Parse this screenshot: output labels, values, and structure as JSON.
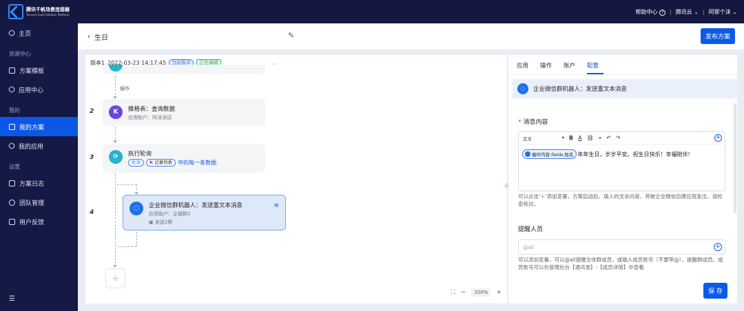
{
  "topbar": {
    "logo_title": "腾讯千帆场景连接器",
    "logo_subtitle": "Tencent SaaS Solution Platform",
    "help": "帮助中心",
    "cloud": "腾讯云",
    "user": "阿那个沫"
  },
  "sidebar": {
    "home": "主页",
    "group_resources": "资源中心",
    "templates": "方案模板",
    "app_center": "应用中心",
    "group_mine": "我的",
    "my_solutions": "我的方案",
    "my_apps": "我的应用",
    "group_settings": "设置",
    "logs": "方案日志",
    "team": "团队管理",
    "feedback": "用户反馈"
  },
  "header": {
    "back_title": "生日",
    "publish": "发布方案"
  },
  "canvas": {
    "version_label": "版本1",
    "version_time": "2022-03-23 14:17:45",
    "badge_current": "当前版本",
    "badge_editing": "正在编辑",
    "op_label": "操作",
    "steps": [
      {
        "num": "2",
        "title": "推格表：查询数据",
        "sub": "应用账户：阿沫测试"
      },
      {
        "num": "3",
        "title": "执行轮询",
        "tag1": "轮询",
        "tag2": "记录列表",
        "tail": "中的每一条数据"
      },
      {
        "num": "4",
        "title": "企业微信群机器人：发送富文本消息",
        "sub": "应用账户：企微群2",
        "sub2": "发送2群"
      }
    ],
    "zoom": "100%"
  },
  "panel": {
    "tabs": [
      "应用",
      "操作",
      "账户",
      "配置"
    ],
    "active_tab": 3,
    "action_title": "企业微信群机器人：发送富文本消息",
    "msg_label": "消息内容",
    "format": "正文",
    "chip": "循环内容.fields.姓名",
    "msg_text": "年年生日，岁岁平安。祝生日快乐！幸福陪伴!",
    "hint1": "可以点击'＋'添加变量，方案启动后、填入的文本内容，将被企业微信自建应用发出、请检查核对。",
    "remind_label": "提醒人员",
    "remind_placeholder": "@all",
    "hint2": "可以添加变量，可以@all提醒全体群成员，或输入成员账号（不要带@），提醒群成员。成员账号可以在管理后台【通讯录】-【成员详情】中查看",
    "save": "保 存"
  },
  "colors": {
    "accent": "#0c5be8",
    "sidebar": "#151946",
    "topbar": "#14173f"
  }
}
